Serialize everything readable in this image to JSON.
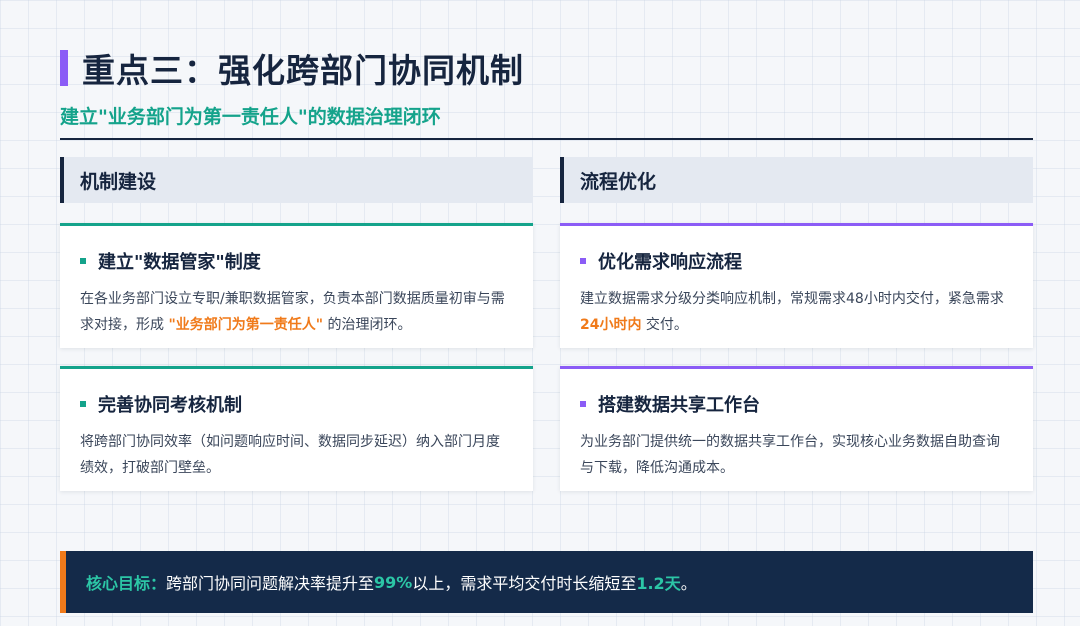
{
  "header": {
    "title": "重点三：强化跨部门协同机制",
    "subtitle": "建立\"业务部门为第一责任人\"的数据治理闭环"
  },
  "columns": [
    {
      "heading": "机制建设",
      "cards": [
        {
          "title": "建立\"数据管家\"制度",
          "body_before": "在各业务部门设立专职/兼职数据管家，负责本部门数据质量初审与需求对接，形成 ",
          "body_highlight": "\"业务部门为第一责任人\"",
          "body_after": " 的治理闭环。"
        },
        {
          "title": "完善协同考核机制",
          "body": "将跨部门协同效率（如问题响应时间、数据同步延迟）纳入部门月度绩效，打破部门壁垒。"
        }
      ]
    },
    {
      "heading": "流程优化",
      "cards": [
        {
          "title": "优化需求响应流程",
          "body_before": "建立数据需求分级分类响应机制，常规需求48小时内交付，紧急需求 ",
          "body_highlight": "24小时内",
          "body_after": " 交付。"
        },
        {
          "title": "搭建数据共享工作台",
          "body": "为业务部门提供统一的数据共享工作台，实现核心业务数据自助查询与下载，降低沟通成本。"
        }
      ]
    }
  ],
  "goal": {
    "label": "核心目标：",
    "text1": "跨部门协同问题解决率提升至 ",
    "num1": "99%",
    "text2": " 以上，需求平均交付时长缩短至 ",
    "num2": "1.2天",
    "text3": "。"
  },
  "colors": {
    "accent_purple": "#8b5cf6",
    "accent_teal": "#14a38b",
    "highlight_orange": "#f07a1a",
    "navy": "#142a49"
  }
}
